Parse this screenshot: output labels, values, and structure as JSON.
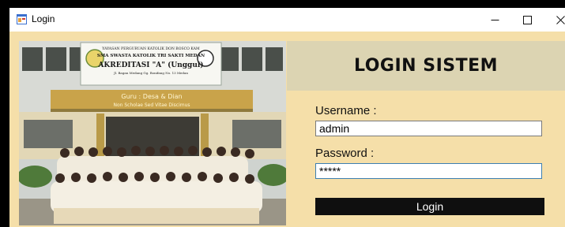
{
  "window": {
    "title": "Login",
    "controls": {
      "minimize": "—",
      "maximize": "☐",
      "close": "✕"
    }
  },
  "photo": {
    "banner_lines": [
      "YAYASAN PERGURUAN KATOLIK DON BOSCO KAM",
      "SMA SWASTA KATOLIK TRI SAKTI MEDAN",
      "AKREDITASI \"A\" (Unggul)",
      "Jl. Bagan Medang Gg. Bonifang No. 13 Medan"
    ],
    "motto_lines": [
      "Guru : Desa & Dian",
      "Non Scholae Sed Vitae Discimus"
    ]
  },
  "login": {
    "header": "LOGIN SISTEM",
    "username_label": "Username :",
    "username_value": "admin",
    "password_label": "Password  :",
    "password_value": "*****",
    "button_label": "Login"
  },
  "colors": {
    "form_background": "#f5dfa9",
    "header_background": "#dcd4b2",
    "button_background": "#0f0f0f",
    "focus_border": "#3c7fb1"
  }
}
